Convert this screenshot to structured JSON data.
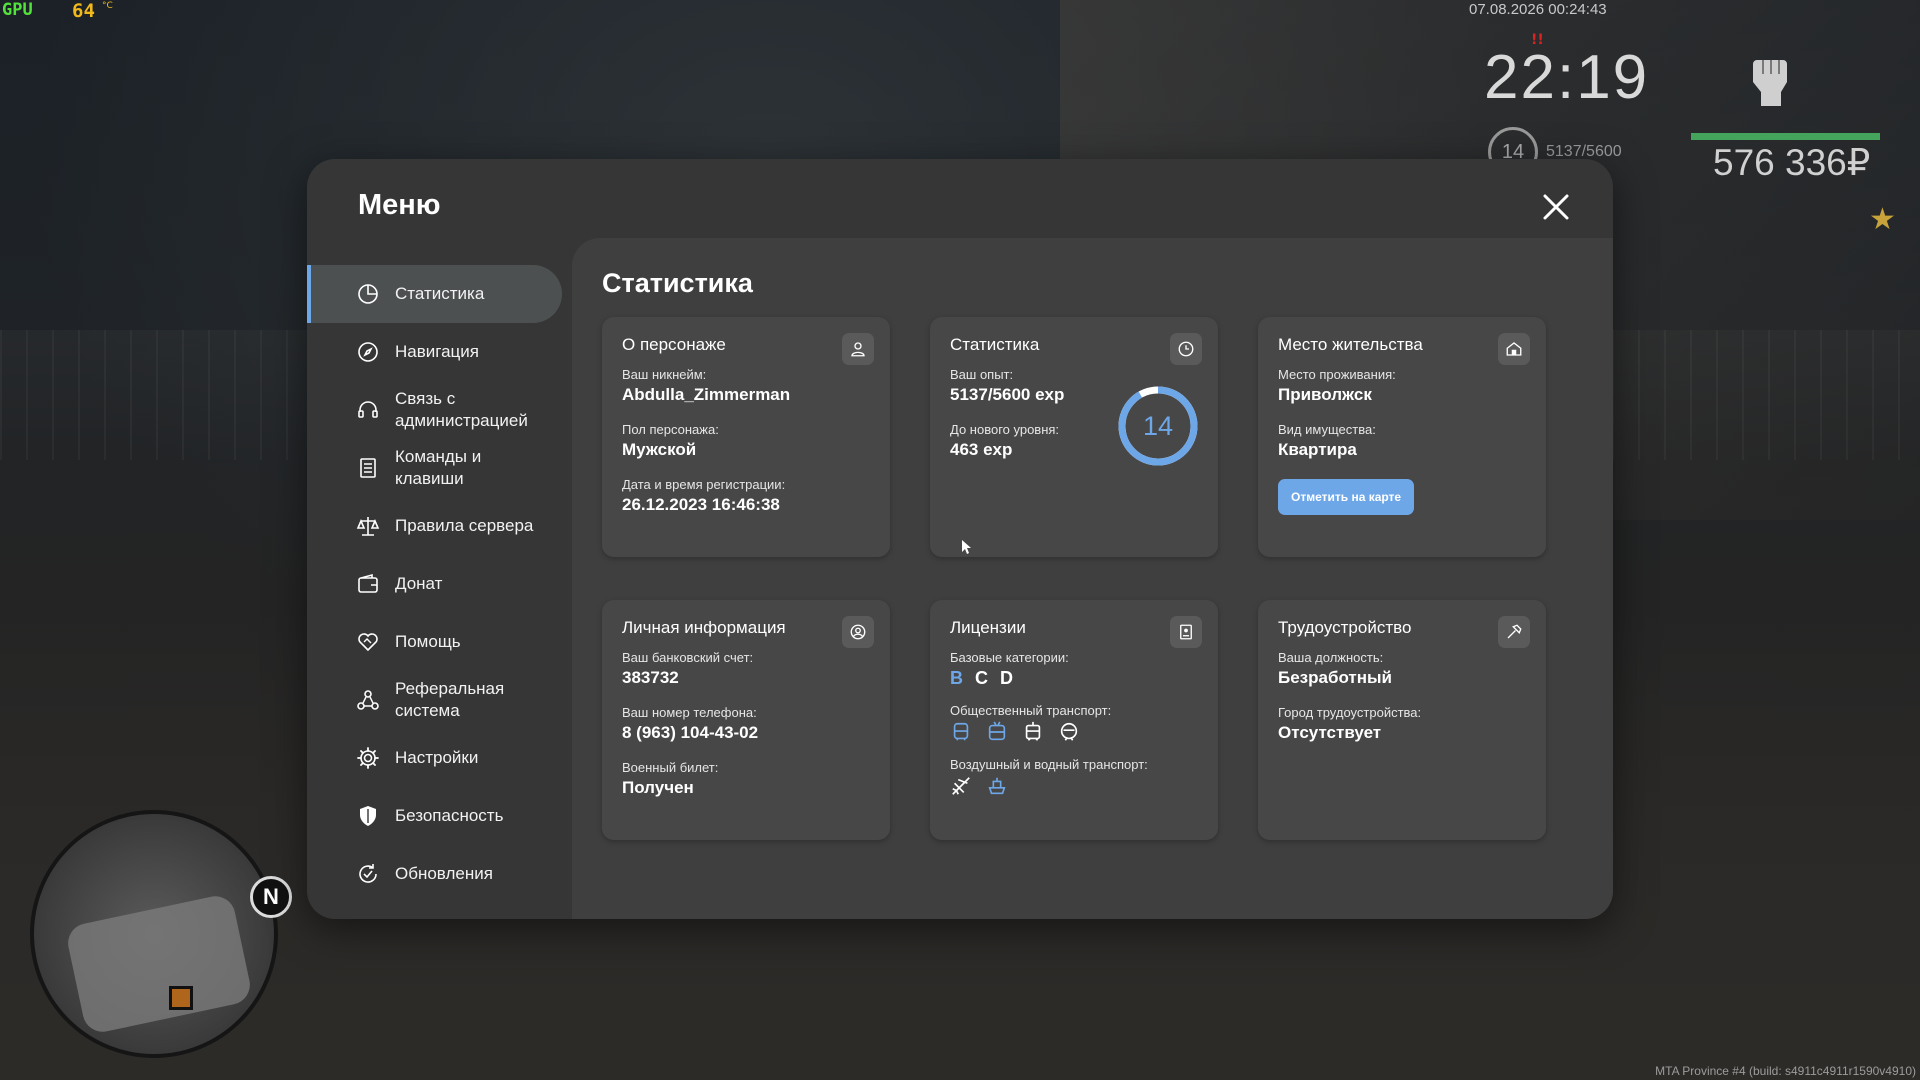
{
  "hud": {
    "gpu_label": "GPU",
    "gpu_temp": "64",
    "gpu_temp_unit": "°C",
    "datetime": "07.08.2026 00:24:43",
    "clock": "22:19",
    "level": "14",
    "exp": "5137/5600",
    "money": "576 336₽",
    "build": "MTA Province #4 (build: s4911c4911r1590v4910)",
    "north": "N",
    "health_fraction": 0.82
  },
  "menu": {
    "title": "Меню",
    "close_icon": "close-icon"
  },
  "sidebar": {
    "items": [
      {
        "label": "Статистика",
        "icon": "pie-chart-icon",
        "active": true
      },
      {
        "label": "Навигация",
        "icon": "compass-icon"
      },
      {
        "label": "Связь с\nадминистрацией",
        "icon": "headset-icon"
      },
      {
        "label": "Команды и\nклавиши",
        "icon": "document-list-icon"
      },
      {
        "label": "Правила сервера",
        "icon": "scales-icon"
      },
      {
        "label": "Донат",
        "icon": "wallet-icon"
      },
      {
        "label": "Помощь",
        "icon": "heart-handshake-icon"
      },
      {
        "label": "Реферальная\nсистема",
        "icon": "referral-network-icon"
      },
      {
        "label": "Настройки",
        "icon": "gear-icon"
      },
      {
        "label": "Безопасность",
        "icon": "shield-icon"
      },
      {
        "label": "Обновления",
        "icon": "refresh-check-icon"
      }
    ]
  },
  "content": {
    "title": "Статистика",
    "cards": {
      "character": {
        "title": "О персонаже",
        "icon": "user-icon",
        "nickname_label": "Ваш никнейм:",
        "nickname": "Abdulla_Zimmerman",
        "gender_label": "Пол персонажа:",
        "gender": "Мужской",
        "reg_label": "Дата и время регистрации:",
        "reg_date": "26.12.2023 16:46:38"
      },
      "stats": {
        "title": "Статистика",
        "icon": "clock-icon",
        "exp_label": "Ваш опыт:",
        "exp": "5137/5600 exp",
        "next_label": "До нового уровня:",
        "next": "463 exp",
        "level": "14",
        "progress": 0.917
      },
      "residence": {
        "title": "Место жительства",
        "icon": "house-icon",
        "place_label": "Место проживания:",
        "place": "Приволжск",
        "property_label": "Вид имущества:",
        "property": "Квартира",
        "button": "Отметить на карте"
      },
      "personal": {
        "title": "Личная информация",
        "icon": "user-circle-icon",
        "bank_label": "Ваш банковский счет:",
        "bank": "383732",
        "phone_label": "Ваш номер телефона:",
        "phone": "8 (963) 104-43-02",
        "military_label": "Военный билет:",
        "military": "Получен"
      },
      "licenses": {
        "title": "Лицензии",
        "icon": "id-card-icon",
        "base_label": "Базовые категории:",
        "categories": [
          {
            "label": "B",
            "active": true
          },
          {
            "label": "C",
            "active": false
          },
          {
            "label": "D",
            "active": false
          }
        ],
        "public_label": "Общественный транспорт:",
        "public_icons": [
          "bus-icon",
          "trolleybus-icon",
          "tram-icon",
          "metro-icon"
        ],
        "air_label": "Воздушный и водный транспорт:",
        "air_icons": [
          "plane-icon",
          "boat-icon"
        ]
      },
      "employment": {
        "title": "Трудоустройство",
        "icon": "hammer-icon",
        "position_label": "Ваша должность:",
        "position": "Безработный",
        "city_label": "Город трудоустройства:",
        "city": "Отсутствует"
      }
    }
  },
  "colors": {
    "accent": "#6ea7e8",
    "window_bg": "#363636",
    "content_bg": "#3f3f3f",
    "card_bg": "#474747",
    "health": "#45a45b"
  }
}
